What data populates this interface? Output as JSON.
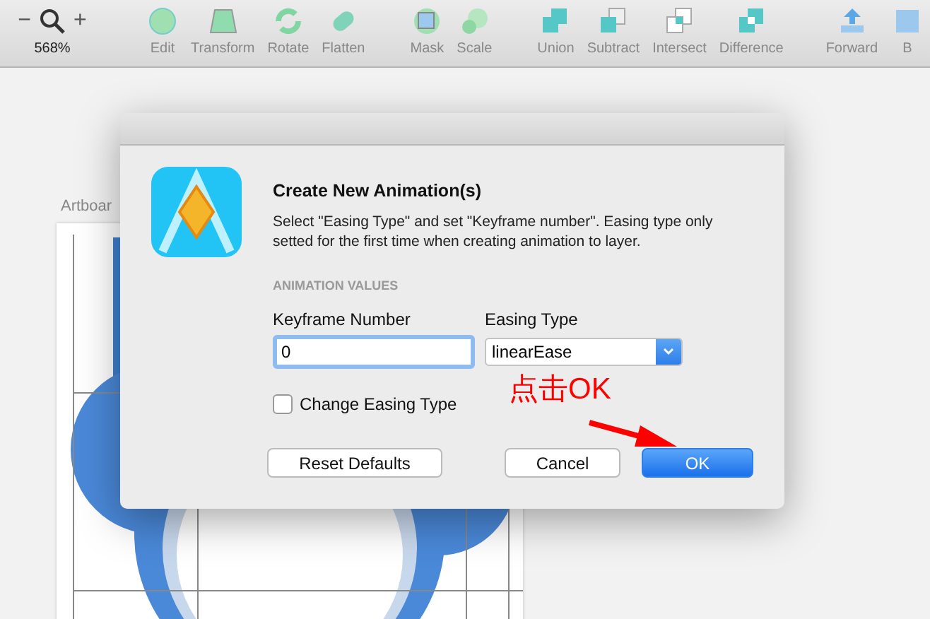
{
  "toolbar": {
    "zoom": {
      "minus": "−",
      "plus": "+",
      "value": "568%"
    },
    "tools": [
      {
        "label": "Edit"
      },
      {
        "label": "Transform"
      },
      {
        "label": "Rotate"
      },
      {
        "label": "Flatten"
      },
      {
        "label": "Mask"
      },
      {
        "label": "Scale"
      },
      {
        "label": "Union"
      },
      {
        "label": "Subtract"
      },
      {
        "label": "Intersect"
      },
      {
        "label": "Difference"
      },
      {
        "label": "Forward"
      },
      {
        "label": "B"
      }
    ]
  },
  "canvas": {
    "artboard_label": "Artboar"
  },
  "dialog": {
    "title": "Create New Animation(s)",
    "description": "Select \"Easing Type\" and set \"Keyframe number\". Easing type only setted for the first time when creating animation to layer.",
    "section": "ANIMATION VALUES",
    "keyframe": {
      "label": "Keyframe Number",
      "value": "0"
    },
    "easing": {
      "label": "Easing Type",
      "value": "linearEase"
    },
    "change_easing": {
      "label": "Change Easing Type",
      "checked": false
    },
    "buttons": [
      {
        "label": "Reset Defaults",
        "primary": false
      },
      {
        "label": "Cancel",
        "primary": false
      },
      {
        "label": "OK",
        "primary": true
      }
    ]
  },
  "annotation": {
    "text": "点击OK"
  }
}
